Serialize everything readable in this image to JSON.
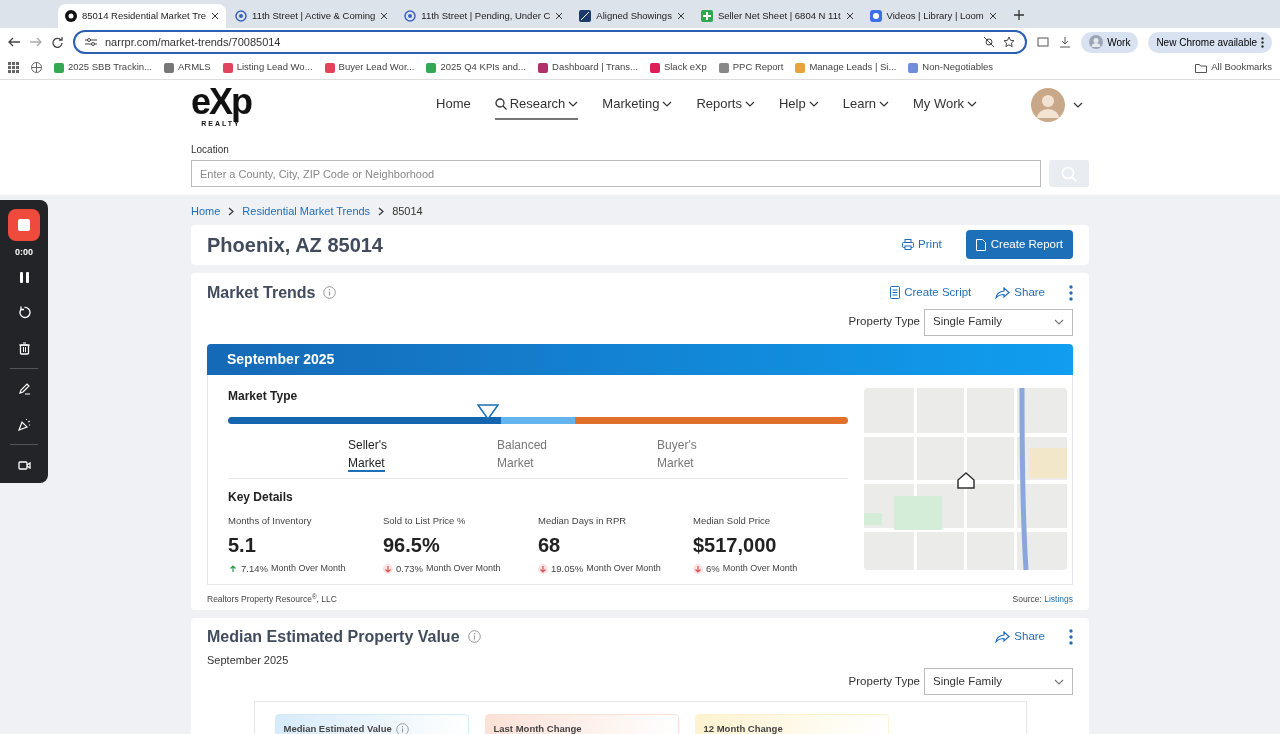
{
  "browser": {
    "tabs": [
      {
        "title": "85014 Residential Market Tre",
        "selected": true
      },
      {
        "title": "11th Street | Active & Coming",
        "selected": false
      },
      {
        "title": "11th Street | Pending, Under C",
        "selected": false
      },
      {
        "title": "Aligned Showings",
        "selected": false
      },
      {
        "title": "Seller Net Sheet | 6804 N 11t",
        "selected": false
      },
      {
        "title": "Videos | Library | Loom",
        "selected": false
      }
    ],
    "url": "narrpr.com/market-trends/70085014",
    "profile": "Work",
    "update": "New Chrome available",
    "bookmarks": [
      {
        "label": "2025 SBB Trackin...",
        "color": "#34a853"
      },
      {
        "label": "ARMLS",
        "color": "#777777"
      },
      {
        "label": "Listing Lead Wo...",
        "color": "#e2445c"
      },
      {
        "label": "Buyer Lead Wor...",
        "color": "#e2445c"
      },
      {
        "label": "2025 Q4 KPIs and...",
        "color": "#34a853"
      },
      {
        "label": "Dashboard | Trans...",
        "color": "#b0306a"
      },
      {
        "label": "Slack eXp",
        "color": "#e01e5a"
      },
      {
        "label": "PPC Report",
        "color": "#888888"
      },
      {
        "label": "Manage Leads | Si...",
        "color": "#e8a33d"
      },
      {
        "label": "Non-Negotiables",
        "color": "#6f8fdc"
      }
    ],
    "all_bookmarks": "All Bookmarks"
  },
  "recorder": {
    "time": "0:00"
  },
  "site": {
    "logo_main": "eXp",
    "logo_sub": "REALTY",
    "nav": [
      {
        "label": "Home",
        "dropdown": false,
        "search_icon": false,
        "selected": false
      },
      {
        "label": "Research",
        "dropdown": true,
        "search_icon": true,
        "selected": true
      },
      {
        "label": "Marketing",
        "dropdown": true,
        "search_icon": false,
        "selected": false
      },
      {
        "label": "Reports",
        "dropdown": true,
        "search_icon": false,
        "selected": false
      },
      {
        "label": "Help",
        "dropdown": true,
        "search_icon": false,
        "selected": false
      },
      {
        "label": "Learn",
        "dropdown": true,
        "search_icon": false,
        "selected": false
      },
      {
        "label": "My Work",
        "dropdown": true,
        "search_icon": false,
        "selected": false
      }
    ],
    "location_label": "Location",
    "location_placeholder": "Enter a County, City, ZIP Code or Neighborhood"
  },
  "breadcrumb": [
    "Home",
    "Residential Market Trends",
    "85014"
  ],
  "page_title": "Phoenix, AZ 85014",
  "print": "Print",
  "create_report": "Create Report",
  "market_trends": {
    "title": "Market Trends",
    "create_script": "Create Script",
    "share": "Share",
    "property_type_label": "Property Type",
    "property_type": "Single Family",
    "period": "September 2025",
    "market_type_title": "Market Type",
    "segments": [
      {
        "label": "Seller's",
        "label2": "Market",
        "selected": true,
        "color": "#1565b0"
      },
      {
        "label": "Balanced",
        "label2": "Market",
        "selected": false,
        "color": "#63b3ec"
      },
      {
        "label": "Buyer's",
        "label2": "Market",
        "selected": false,
        "color": "#e0702a"
      }
    ],
    "key_details_title": "Key Details",
    "details": [
      {
        "label": "Months of Inventory",
        "value": "5.1",
        "rising": true,
        "change": "7.14%",
        "note": "Month Over Month"
      },
      {
        "label": "Sold to List Price %",
        "value": "96.5%",
        "rising": false,
        "change": "0.73%",
        "note": "Month Over Month"
      },
      {
        "label": "Median Days in RPR",
        "value": "68",
        "rising": false,
        "change": "19.05%",
        "note": "Month Over Month"
      },
      {
        "label": "Median Sold Price",
        "value": "$517,000",
        "rising": false,
        "change": "6%",
        "note": "Month Over Month"
      }
    ],
    "footer_left": "Realtors Property Resource$^{®}$, LLC",
    "source_label": "Source:",
    "source": "Listings"
  },
  "median_value": {
    "title": "Median Estimated Property Value",
    "period": "September 2025",
    "share": "Share",
    "property_type_label": "Property Type",
    "property_type": "Single Family",
    "cards": [
      {
        "label": "Median Estimated Value",
        "info": true,
        "color": "#d6ebfa"
      },
      {
        "label": "Last Month Change",
        "info": false,
        "color": "#fbe1d6"
      },
      {
        "label": "12 Month Change",
        "info": false,
        "color": "#fdf3d0"
      }
    ]
  }
}
